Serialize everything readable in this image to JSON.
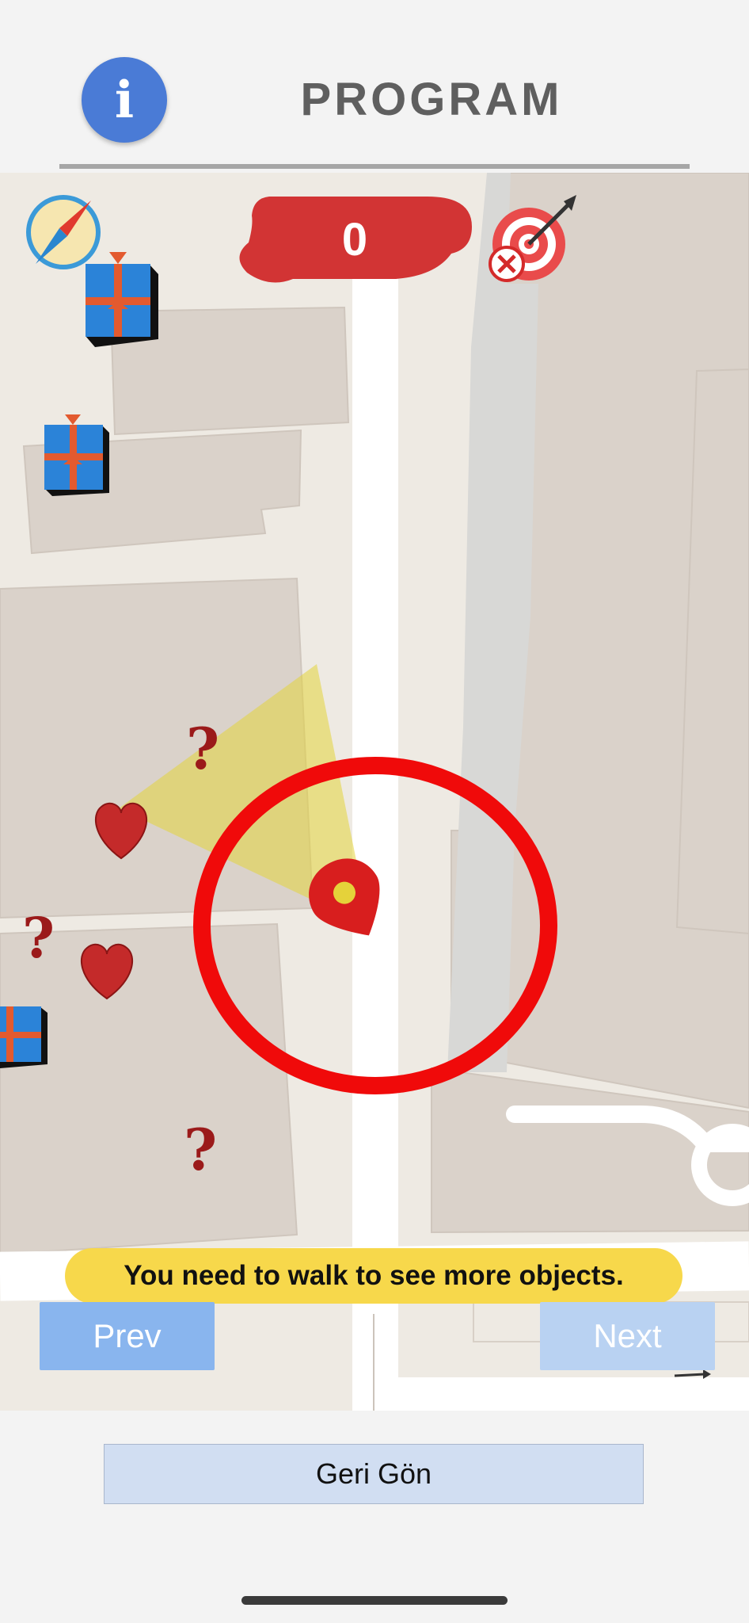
{
  "header": {
    "info_glyph": "i",
    "title": "PROGRAM"
  },
  "game": {
    "score": "0",
    "hint": "You need to walk to see more objects.",
    "prev_label": "Prev",
    "next_label": "Next"
  },
  "footer": {
    "back_label": "Geri Gön"
  },
  "icons": {
    "info": "info-icon",
    "compass": "compass-icon",
    "target": "target-miss-icon",
    "gift": "gift-box-icon",
    "heart": "heart-icon",
    "question": "question-mark-icon",
    "player": "location-pin-icon"
  },
  "colors": {
    "info_blue": "#4a7bd6",
    "score_red": "#d23434",
    "radius_red": "#f00a0a",
    "hint_yellow": "#f7d84b",
    "prev_blue": "#89b5ee",
    "next_blue": "#b9d2f2",
    "back_button": "#d1def2"
  }
}
